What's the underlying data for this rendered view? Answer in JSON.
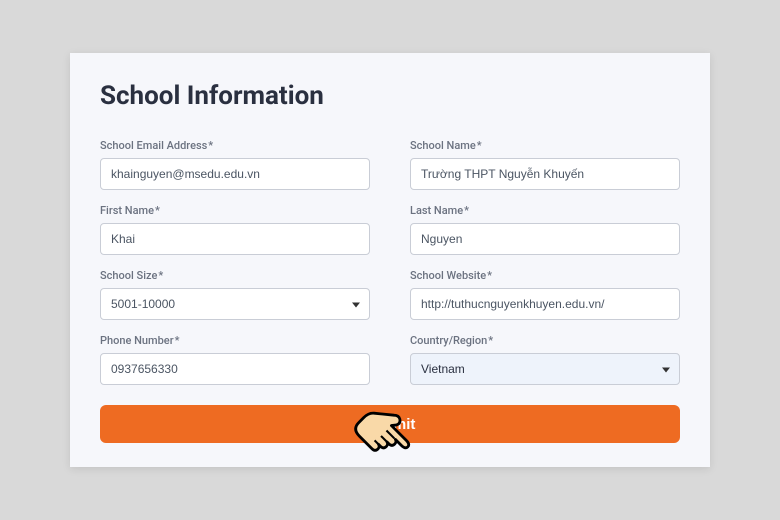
{
  "title": "School Information",
  "fields": {
    "email": {
      "label": "School Email Address",
      "required": "*",
      "value": "khainguyen@msedu.edu.vn"
    },
    "schoolName": {
      "label": "School Name",
      "required": "*",
      "value": "Trường THPT Nguyễn Khuyến"
    },
    "firstName": {
      "label": "First Name",
      "required": "*",
      "value": "Khai"
    },
    "lastName": {
      "label": "Last Name",
      "required": "*",
      "value": "Nguyen"
    },
    "schoolSize": {
      "label": "School Size",
      "required": "*",
      "value": "5001-10000"
    },
    "schoolWebsite": {
      "label": "School Website",
      "required": "*",
      "value": "http://tuthucnguyenkhuyen.edu.vn/"
    },
    "phone": {
      "label": "Phone Number",
      "required": "*",
      "value": "0937656330"
    },
    "country": {
      "label": "Country/Region",
      "required": "*",
      "value": "Vietnam"
    }
  },
  "submitLabel": "Submit"
}
